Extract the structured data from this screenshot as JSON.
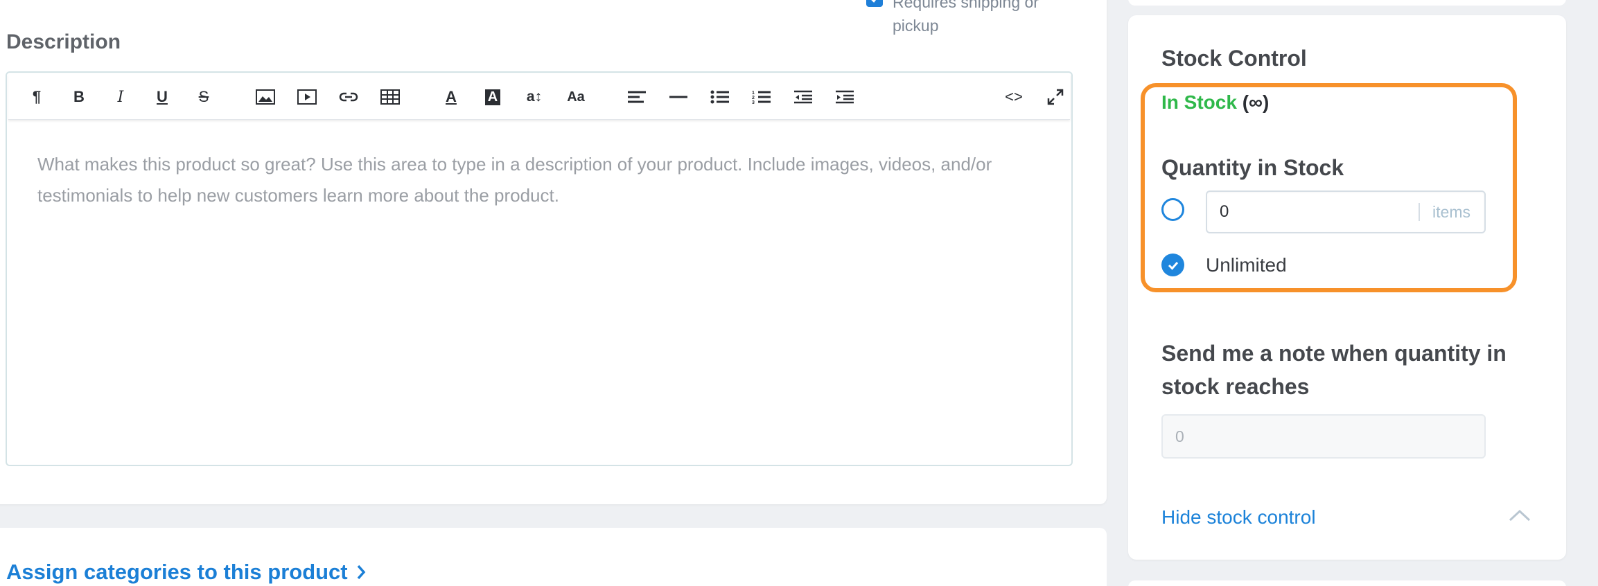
{
  "shipping": {
    "label": "Requires shipping or pickup",
    "checked": true
  },
  "description": {
    "label": "Description",
    "placeholder": "What makes this product so great? Use this area to type in a description of your product. Include images, videos, and/or testimonials to help new customers learn more about the product.",
    "toolbar": [
      {
        "name": "paragraph-icon",
        "glyph": "¶"
      },
      {
        "name": "bold-icon",
        "glyph": "B"
      },
      {
        "name": "italic-icon",
        "glyph": "I"
      },
      {
        "name": "underline-icon",
        "glyph": "U"
      },
      {
        "name": "strikethrough-icon",
        "glyph": "S"
      },
      {
        "name": "image-icon"
      },
      {
        "name": "video-icon"
      },
      {
        "name": "link-icon"
      },
      {
        "name": "table-icon"
      },
      {
        "name": "text-color-icon",
        "glyph": "A"
      },
      {
        "name": "background-color-icon",
        "glyph": "A"
      },
      {
        "name": "line-height-icon",
        "glyph": "a↕"
      },
      {
        "name": "font-size-icon",
        "glyph": "Aa"
      },
      {
        "name": "align-left-icon"
      },
      {
        "name": "horizontal-rule-icon"
      },
      {
        "name": "bullet-list-icon"
      },
      {
        "name": "numbered-list-icon"
      },
      {
        "name": "outdent-icon"
      },
      {
        "name": "indent-icon"
      },
      {
        "name": "code-view-icon",
        "glyph": "<>"
      },
      {
        "name": "fullscreen-icon"
      }
    ]
  },
  "categories": {
    "link": "Assign categories to this product"
  },
  "stock": {
    "title": "Stock Control",
    "status": "In Stock",
    "status_suffix": "(∞)",
    "status_color": "#2fb84a",
    "highlight_color": "#f7912a",
    "quantity_label": "Quantity in Stock",
    "quantity_value": "0",
    "quantity_unit": "items",
    "unlimited_label": "Unlimited",
    "unlimited_selected": true,
    "note_label": "Send me a note when quantity in stock reaches",
    "note_value": "0",
    "hide_link": "Hide stock control"
  }
}
